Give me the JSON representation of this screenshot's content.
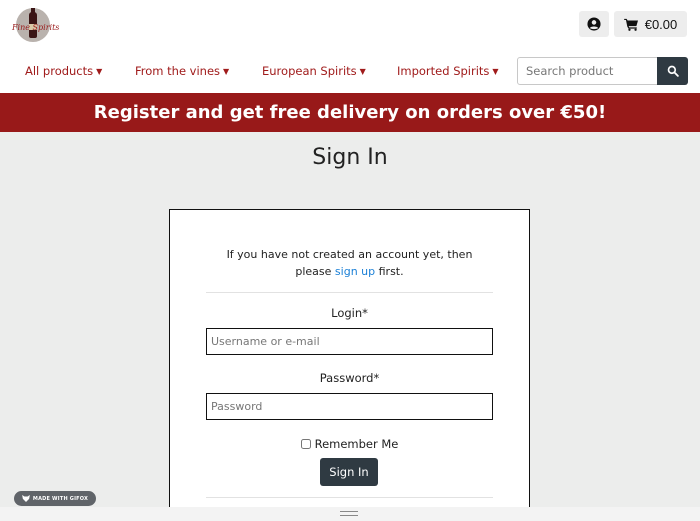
{
  "header": {
    "logo_text": "Fine Spirits",
    "account_icon": "user-circle-icon",
    "cart_icon": "shopping-cart-icon",
    "cart_total": "€0.00"
  },
  "nav": {
    "items": [
      {
        "label": "All products"
      },
      {
        "label": "From the vines"
      },
      {
        "label": "European Spirits"
      },
      {
        "label": "Imported Spirits"
      }
    ],
    "search_placeholder": "Search product",
    "search_icon": "search-icon"
  },
  "promo": {
    "text": "Register and get free delivery on orders over €50!"
  },
  "signin": {
    "title": "Sign In",
    "intro_before": "If you have not created an account yet, then",
    "intro_please": "please ",
    "intro_link": "sign up",
    "intro_after": " first.",
    "login_label": "Login*",
    "login_placeholder": "Username or e-mail",
    "password_label": "Password*",
    "password_placeholder": "Password",
    "remember_label": "Remember Me",
    "button_label": "Sign In"
  },
  "overlay": {
    "gifox_badge": "MADE WITH GIFOX"
  },
  "colors": {
    "brand_red": "#981919",
    "nav_text": "#a01b1b",
    "dark_button": "#2f3a42",
    "link_blue": "#1a7fd6",
    "page_background": "#ecedec"
  }
}
